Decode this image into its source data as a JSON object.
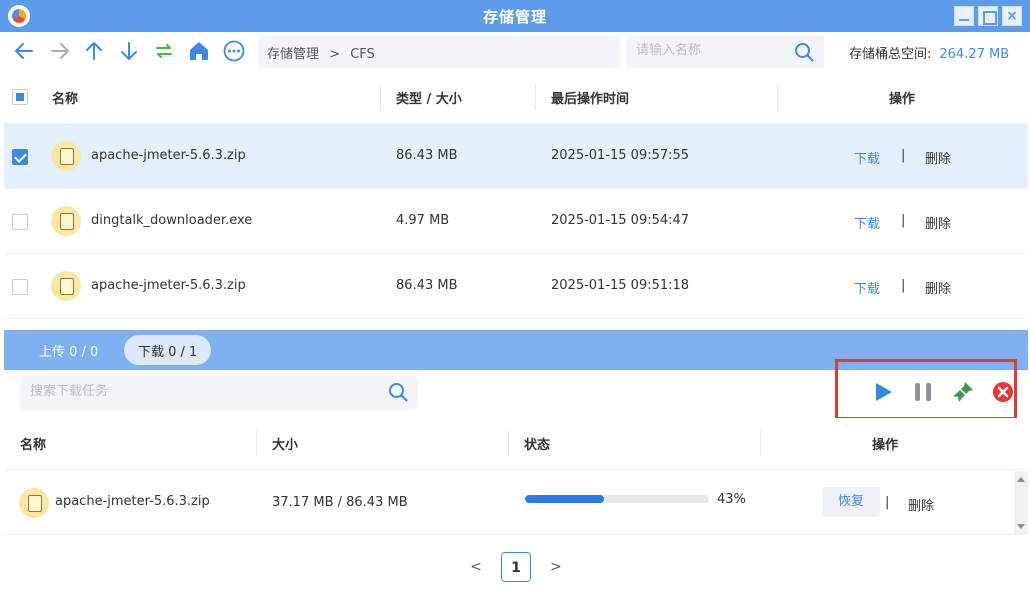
{
  "window": {
    "title": "存储管理"
  },
  "toolbar": {
    "breadcrumb": [
      "存储管理",
      ">",
      "CFS"
    ],
    "search_placeholder": "请输入名称",
    "capacity_label": "存储桶总空间:",
    "capacity_value": "264.27 MB"
  },
  "files": {
    "headers": [
      "名称",
      "类型 / 大小",
      "最后操作时间",
      "操作"
    ],
    "rows": [
      {
        "name": "apache-jmeter-5.6.3.zip",
        "size": "86.43 MB",
        "time": "2025-01-15 09:57:55",
        "selected": true,
        "download": "下载",
        "sep": "|",
        "delete": "删除"
      },
      {
        "name": "dingtalk_downloader.exe",
        "size": "4.97 MB",
        "time": "2025-01-15 09:54:47",
        "selected": false,
        "download": "下载",
        "sep": "|",
        "delete": "删除"
      },
      {
        "name": "apache-jmeter-5.6.3.zip",
        "size": "86.43 MB",
        "time": "2025-01-15 09:51:18",
        "selected": false,
        "download": "下载",
        "sep": "|",
        "delete": "删除"
      }
    ]
  },
  "transfer": {
    "tabs": [
      {
        "label": "上传 0 / 0",
        "active": false
      },
      {
        "label": "下载 0 / 1",
        "active": true
      }
    ],
    "search_placeholder": "搜索下载任务",
    "headers": [
      "名称",
      "大小",
      "状态",
      "操作"
    ],
    "rows": [
      {
        "name": "apache-jmeter-5.6.3.zip",
        "size": "37.17 MB / 86.43 MB",
        "progress": 0.43,
        "progress_label": "43%",
        "restore": "恢复",
        "sep": "|",
        "delete": "删除"
      }
    ],
    "controls": [
      "play-icon",
      "pause-icon",
      "clear-icon",
      "cancel-icon"
    ]
  },
  "pagination": {
    "prev": "<",
    "current": "1",
    "next": ">"
  },
  "colors": {
    "accent": "#3f8ae0",
    "titlebar": "#5b9bea",
    "highlight": "#e53935",
    "progress": "#2f7be5"
  }
}
